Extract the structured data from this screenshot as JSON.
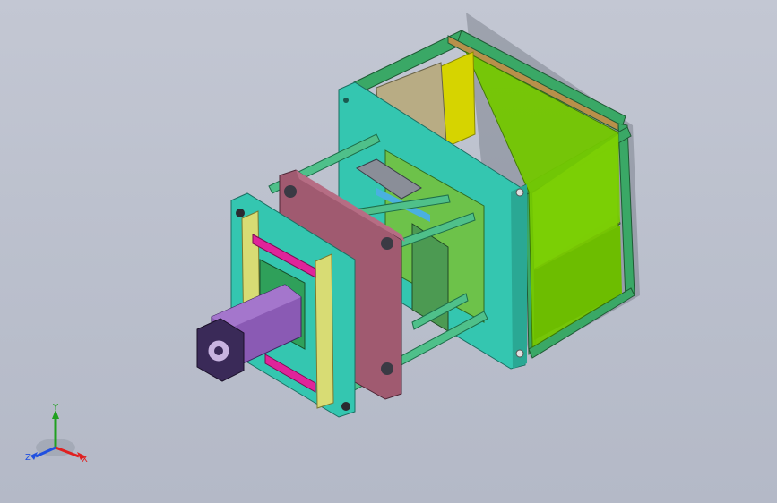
{
  "viewport": {
    "background": "#bdc1cd",
    "triad": {
      "x_label": "X",
      "y_label": "Y",
      "z_label": "Z",
      "x_color": "#e02020",
      "y_color": "#20a020",
      "z_color": "#2050e0"
    }
  },
  "model": {
    "colors": {
      "frame": "#2e9a5c",
      "back_plate": "#34c6b0",
      "green_wall": "#74c800",
      "yellow_panel": "#d6d400",
      "tie_bar": "#4fc08a",
      "maroon_plate": "#a05a70",
      "front_plate": "#34c6b0",
      "yellow_bar": "#d8dc74",
      "magenta_bar": "#e0249a",
      "cylinder": "#8a5ab4",
      "mold_green": "#4c9a52"
    }
  }
}
